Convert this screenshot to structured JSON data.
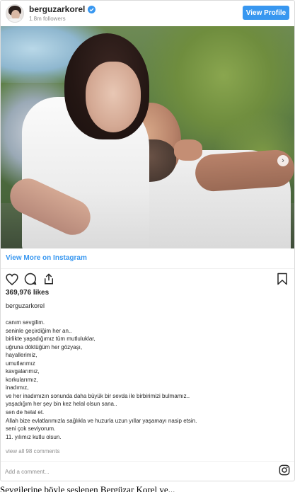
{
  "header": {
    "username": "berguzarkorel",
    "followers": "1.8m followers",
    "view_profile": "View Profile"
  },
  "post": {
    "view_more": "View More on Instagram",
    "likes": "369,976 likes",
    "caption_user": "berguzarkorel",
    "caption_lines": [
      "canım sevgilim.",
      "seninle geçirdiğim her an..",
      "birlikte yaşadığımız tüm mutluluklar,",
      "uğruna döktüğüm her gözyaşı,",
      "hayallerimiz,",
      "umutlarımız",
      "kavgalarımız,",
      "korkularımız,",
      "inadımız,",
      "ve her inadımızın sonunda daha büyük bir sevda ile birbirimizi bulmamız..",
      "yaşadığım her şey bin kez helal olsun sana..",
      "sen de helal et.",
      "Allah bize evlatlarımızla sağlıkla ve huzurla uzun yıllar yaşamayı nasip etsin.",
      "seni çok seviyorum.",
      "11. yılımız kutlu olsun."
    ],
    "comments_link": "view all 98 comments",
    "carousel": {
      "slides": 4,
      "active_index": 0
    }
  },
  "comment_box": {
    "placeholder": "Add a comment..."
  },
  "below_text": "Sevgilerine böyle seslenen Bergüzar Korel ve...",
  "colors": {
    "accent": "#3897f0",
    "muted": "#8e8e8e",
    "text": "#262626"
  },
  "icons": [
    "verified-badge-icon",
    "heart-icon",
    "comment-icon",
    "share-icon",
    "bookmark-icon",
    "carousel-next-icon",
    "instagram-icon"
  ]
}
